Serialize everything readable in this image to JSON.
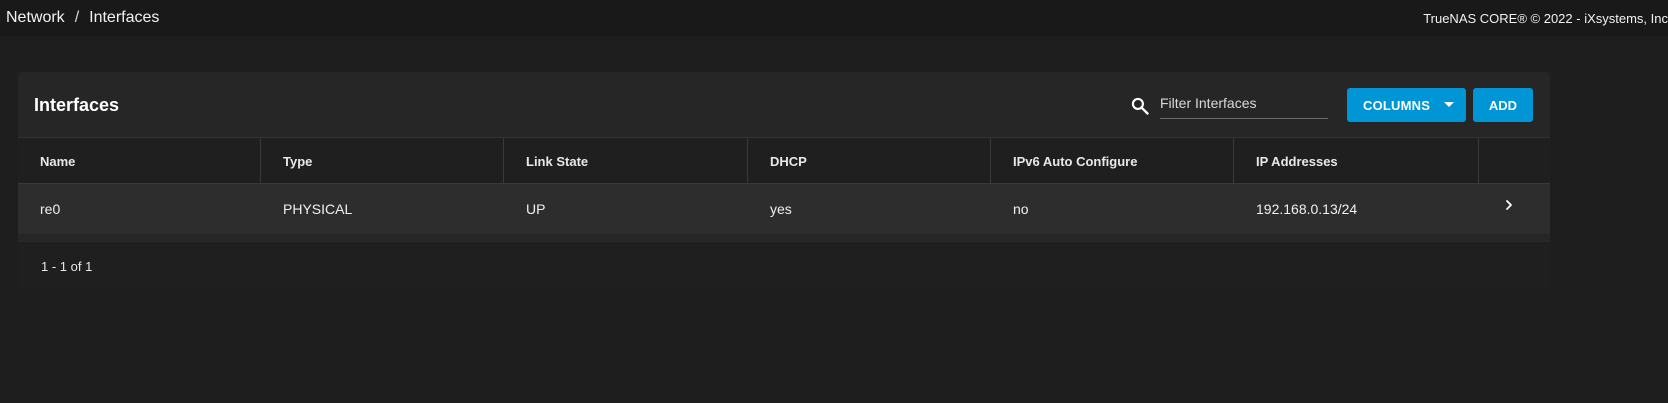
{
  "breadcrumb": {
    "items": [
      "Network",
      "Interfaces"
    ],
    "separator": "/"
  },
  "copyright": "TrueNAS CORE® © 2022 - iXsystems, Inc",
  "card": {
    "title": "Interfaces",
    "search": {
      "placeholder": "Filter Interfaces",
      "value": ""
    },
    "columns_label": "COLUMNS",
    "add_label": "ADD"
  },
  "table": {
    "headers": [
      "Name",
      "Type",
      "Link State",
      "DHCP",
      "IPv6 Auto Configure",
      "IP Addresses"
    ],
    "rows": [
      {
        "name": "re0",
        "type": "PHYSICAL",
        "link_state": "UP",
        "dhcp": "yes",
        "ipv6_auto": "no",
        "ip_addresses": "192.168.0.13/24"
      }
    ],
    "pagination": "1 - 1 of 1"
  },
  "colors": {
    "accent": "#0095d5",
    "background": "#1e1e1e",
    "card": "#262626",
    "row": "#2d2d2d"
  },
  "icons": {
    "search": "search-icon",
    "row_expand": "chevron-right-icon",
    "dropdown": "caret-down-icon"
  }
}
